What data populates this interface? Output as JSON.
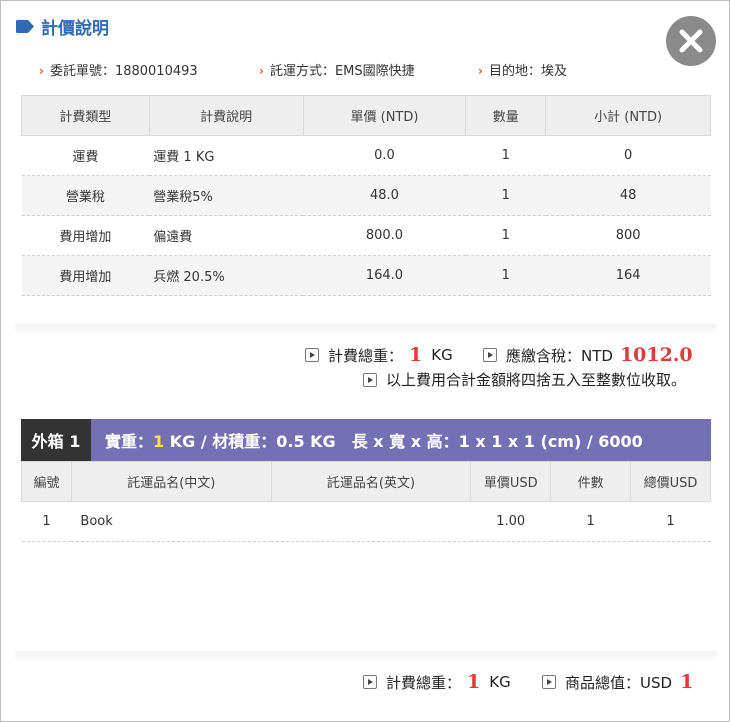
{
  "title": "計價說明",
  "info": {
    "order_no": "委託單號：1880010493",
    "shipping_method": "託運方式：EMS國際快捷",
    "destination": "目的地：埃及"
  },
  "fee_table": {
    "headers": [
      "計費類型",
      "計費說明",
      "單價 (NTD)",
      "數量",
      "小計 (NTD)"
    ],
    "rows": [
      [
        "運費",
        "運費 1 KG",
        "0.0",
        "1",
        "0"
      ],
      [
        "營業稅",
        "營業稅5%",
        "48.0",
        "1",
        "48"
      ],
      [
        "費用增加",
        "偏遠費",
        "800.0",
        "1",
        "800"
      ],
      [
        "費用增加",
        "兵燃 20.5%",
        "164.0",
        "1",
        "164"
      ]
    ]
  },
  "summary1": {
    "weight_label": "計費總重：",
    "weight_value": "1",
    "weight_unit": "KG",
    "total_label": "應繳含稅：NTD",
    "total_value": "1012.0",
    "note": "以上費用合計金額將四捨五入至整數位收取。"
  },
  "box": {
    "label": "外箱 1",
    "actual_weight_label": "實重：",
    "actual_weight_value": "1",
    "rest": " KG / 材積重：0.5 KG　長 x 寬 x 高：1 x 1 x 1 (cm) / 6000"
  },
  "item_table": {
    "headers": [
      "編號",
      "託運品名(中文)",
      "託運品名(英文)",
      "單價USD",
      "件數",
      "總價USD"
    ],
    "rows": [
      [
        "1",
        "Book",
        "",
        "1.00",
        "1",
        "1"
      ]
    ]
  },
  "summary2": {
    "weight_label": "計費總重：",
    "weight_value": "1",
    "weight_unit": "KG",
    "value_label": "商品總值：USD",
    "value_value": "1"
  },
  "colors": {
    "title_blue": "#2f6bb5",
    "accent_orange": "#e05a1e",
    "red_value": "#e03a3a",
    "box_header_purple": "#7570b4",
    "box_label_dark": "#333333",
    "yellow_highlight": "#ffe24a",
    "close_button_gray": "#8a8a8a"
  },
  "icons": {
    "title": "tag-icon",
    "close": "close-icon",
    "info_bullet": "chevron-right-icon",
    "summary_bullet": "arrow-right-box-icon"
  }
}
